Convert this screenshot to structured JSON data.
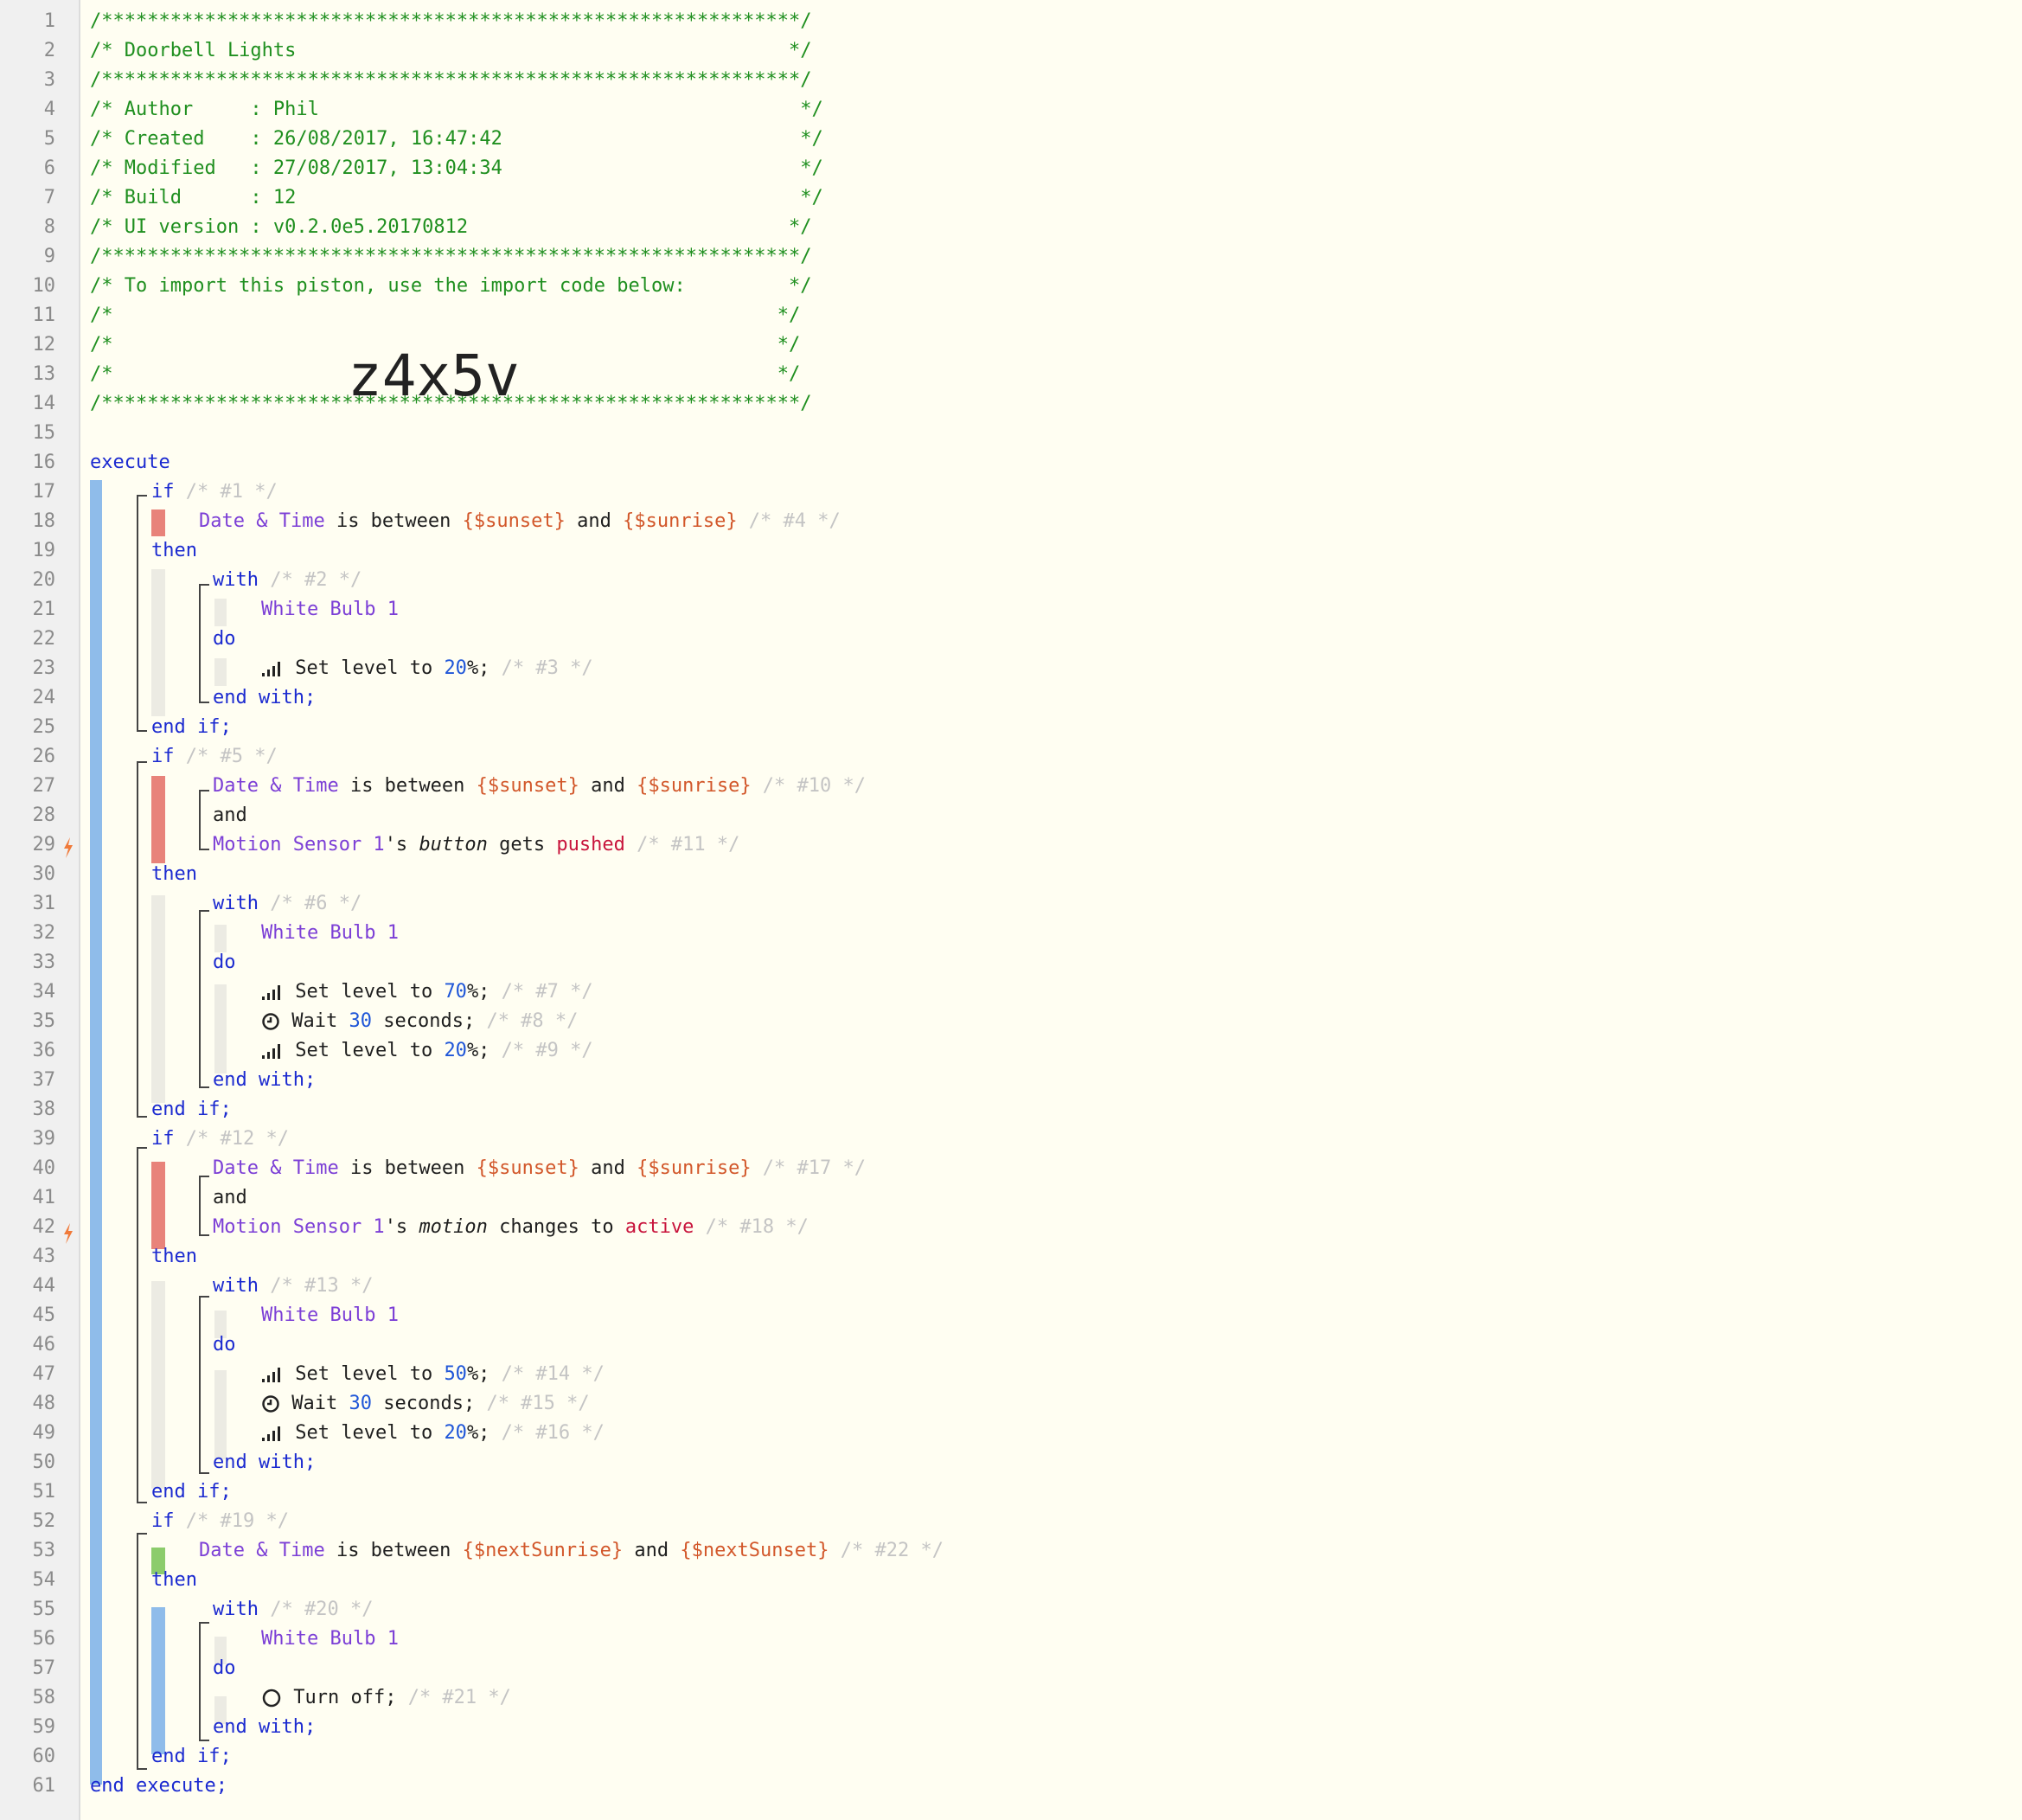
{
  "editor": {
    "line_numbers": [
      "1",
      "2",
      "3",
      "4",
      "5",
      "6",
      "7",
      "8",
      "9",
      "10",
      "11",
      "12",
      "13",
      "14",
      "15",
      "16",
      "17",
      "18",
      "19",
      "20",
      "21",
      "22",
      "23",
      "24",
      "25",
      "26",
      "27",
      "28",
      "29",
      "30",
      "31",
      "32",
      "33",
      "34",
      "35",
      "36",
      "37",
      "38",
      "39",
      "40",
      "41",
      "42",
      "43",
      "44",
      "45",
      "46",
      "47",
      "48",
      "49",
      "50",
      "51",
      "52",
      "53",
      "54",
      "55",
      "56",
      "57",
      "58",
      "59",
      "60",
      "61"
    ],
    "header": {
      "stars": "/*************************************************************/",
      "title": "/* Doorbell Lights                                           */",
      "author": "/* Author     : Phil                                          */",
      "created": "/* Created    : 26/08/2017, 16:47:42                          */",
      "modified": "/* Modified   : 27/08/2017, 13:04:34                          */",
      "build": "/* Build      : 12                                            */",
      "ui_version": "/* UI version : v0.2.0e5.20170812                            */",
      "import_note": "/* To import this piston, use the import code below:         */",
      "empty": "/*                                                          */",
      "import_code": "z4x5v"
    },
    "kw": {
      "execute": "execute",
      "end_execute": "end execute;",
      "if": "if",
      "then": "then",
      "with": "with",
      "do": "do",
      "end_with": "end with;",
      "end_if": "end if;",
      "and": "and"
    },
    "common": {
      "date_time": "Date & Time",
      "is_between": " is between ",
      "and_word": " and ",
      "sunset": "{$sunset}",
      "sunrise": "{$sunrise}",
      "next_sunrise": "{$nextSunrise}",
      "next_sunset": "{$nextSunset}",
      "white_bulb": "White Bulb 1",
      "motion_sensor": "Motion Sensor 1",
      "possessive": "'s ",
      "button": "button",
      "gets": " gets ",
      "pushed": "pushed",
      "motion": "motion",
      "changes_to": " changes to ",
      "active": "active",
      "set_level_to": " Set level to ",
      "wait": " Wait ",
      "seconds": " seconds;",
      "turn_off": " Turn off;",
      "pct_semicolon": "%;",
      "v20": "20",
      "v70": "70",
      "v50": "50",
      "v30": "30"
    },
    "comments": {
      "c1": " /* #1 */",
      "c2": " /* #2 */",
      "c3": " /* #3 */",
      "c4": " /* #4 */",
      "c5": " /* #5 */",
      "c6": " /* #6 */",
      "c7": " /* #7 */",
      "c8": " /* #8 */",
      "c9": " /* #9 */",
      "c10": " /* #10 */",
      "c11": " /* #11 */",
      "c12": " /* #12 */",
      "c13": " /* #13 */",
      "c14": " /* #14 */",
      "c15": " /* #15 */",
      "c16": " /* #16 */",
      "c17": " /* #17 */",
      "c18": " /* #18 */",
      "c19": " /* #19 */",
      "c20": " /* #20 */",
      "c21": " /* #21 */",
      "c22": " /* #22 */"
    },
    "icons": [
      "signal-bars-icon",
      "clock-icon",
      "power-icon",
      "lightning-bolt-icon"
    ],
    "colors": {
      "header_comment": "#1f8f1f",
      "keyword": "#1b2ad0",
      "device": "#7c3fd6",
      "number": "#1f56d8",
      "variable": "#d2572a",
      "value": "#c8143c",
      "block_bar": "#8fbcea",
      "false_condition": "#e8837a",
      "true_condition": "#8ccc6c"
    }
  }
}
